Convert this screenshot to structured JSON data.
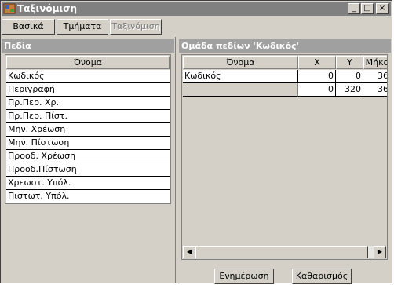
{
  "window": {
    "title": "Ταξινόμιση",
    "minimize": "_",
    "maximize": "□",
    "close": "×"
  },
  "toolbar": {
    "tabs": [
      {
        "label": "Βασικά",
        "enabled": true
      },
      {
        "label": "Τμήματα",
        "enabled": true
      },
      {
        "label": "Ταξινόμιση",
        "enabled": false
      }
    ]
  },
  "left_panel": {
    "title": "Πεδία",
    "column_header": "Όνομα",
    "items": [
      "Κωδικός",
      "Περιγραφή",
      "Πρ.Περ. Χρ.",
      "Πρ.Περ. Πίστ.",
      "Μην. Χρέωση",
      "Μην. Πίστωση",
      "Προοδ. Χρέωση",
      "Προοδ.Πίστωση",
      "Χρεωστ. Υπόλ.",
      "Πιστωτ. Υπόλ."
    ]
  },
  "right_panel": {
    "title": "Ομάδα πεδίων 'Κωδικός'",
    "columns": [
      "Όνομα",
      "X",
      "Y",
      "Μήκο"
    ],
    "rows": [
      [
        "Κωδικός",
        "0",
        "0",
        "36"
      ],
      [
        "",
        "0",
        "320",
        "36"
      ]
    ]
  },
  "buttons": {
    "update": "Ενημέρωση",
    "clear": "Καθαρισμός"
  },
  "scrollbar": {
    "left_arrow": "◀",
    "right_arrow": "▶"
  }
}
